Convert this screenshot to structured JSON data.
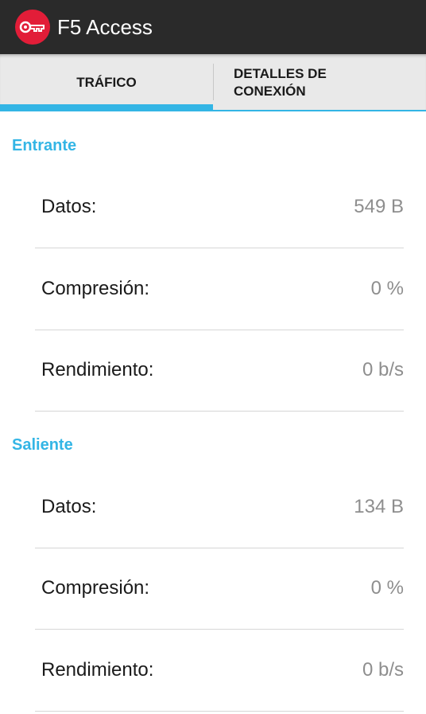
{
  "app": {
    "title": "F5 Access"
  },
  "tabs": [
    {
      "label": "TRÁFICO",
      "selected": true
    },
    {
      "label": "DETALLES DE\nCONEXIÓN",
      "selected": false
    }
  ],
  "colors": {
    "accent": "#33b5e5",
    "brand": "#e21d38",
    "appbar": "#2a2a2a"
  },
  "sections": {
    "incoming": {
      "title": "Entrante",
      "rows": [
        {
          "label": "Datos:",
          "value": "549 B"
        },
        {
          "label": "Compresión:",
          "value": "0 %"
        },
        {
          "label": "Rendimiento:",
          "value": "0 b/s"
        }
      ]
    },
    "outgoing": {
      "title": "Saliente",
      "rows": [
        {
          "label": "Datos:",
          "value": "134 B"
        },
        {
          "label": "Compresión:",
          "value": "0 %"
        },
        {
          "label": "Rendimiento:",
          "value": "0 b/s"
        }
      ]
    }
  }
}
